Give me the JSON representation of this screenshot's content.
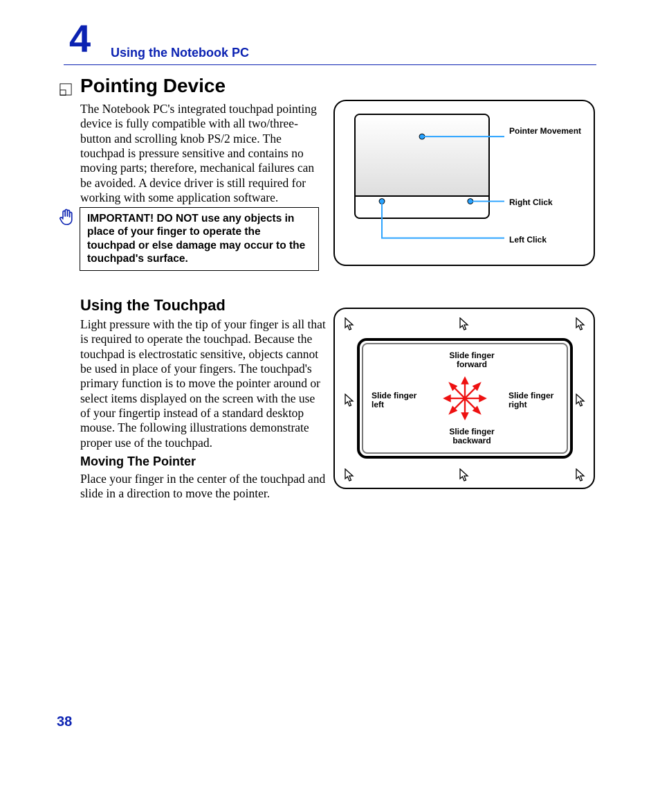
{
  "chapter": {
    "number": "4",
    "title": "Using the Notebook PC"
  },
  "page_number": "38",
  "sections": {
    "pointing_device": {
      "title": "Pointing Device",
      "body": "The Notebook PC's integrated touchpad pointing device is fully compatible with all two/three-button and scrolling knob PS/2 mice. The touchpad is pressure sensitive and contains no moving parts; therefore, mechanical failures can be avoided. A device driver is still required for working with some application software.",
      "important": "IMPORTANT! DO NOT use any objects in place of your finger to operate the touchpad or else damage may occur to the touchpad's surface."
    },
    "using_touchpad": {
      "title": "Using the Touchpad",
      "body": "Light pressure with the tip of your finger is all that is required to operate the touchpad. Because the touchpad is electrostatic sensitive, objects cannot be used in place of your fingers. The touchpad's primary function is to move the pointer around or select items displayed on the screen with the use of your fingertip instead of a standard desktop mouse. The following illustrations demonstrate proper use of the touchpad."
    },
    "moving_pointer": {
      "title": "Moving The Pointer",
      "body": "Place your finger in the center of the touchpad and slide in a direction to move the pointer."
    }
  },
  "figure1": {
    "labels": {
      "pointer_movement": "Pointer Movement",
      "right_click": "Right Click",
      "left_click": "Left Click"
    }
  },
  "figure2": {
    "labels": {
      "forward": "Slide finger forward",
      "backward": "Slide finger backward",
      "left": "Slide finger left",
      "right": "Slide finger right"
    }
  }
}
